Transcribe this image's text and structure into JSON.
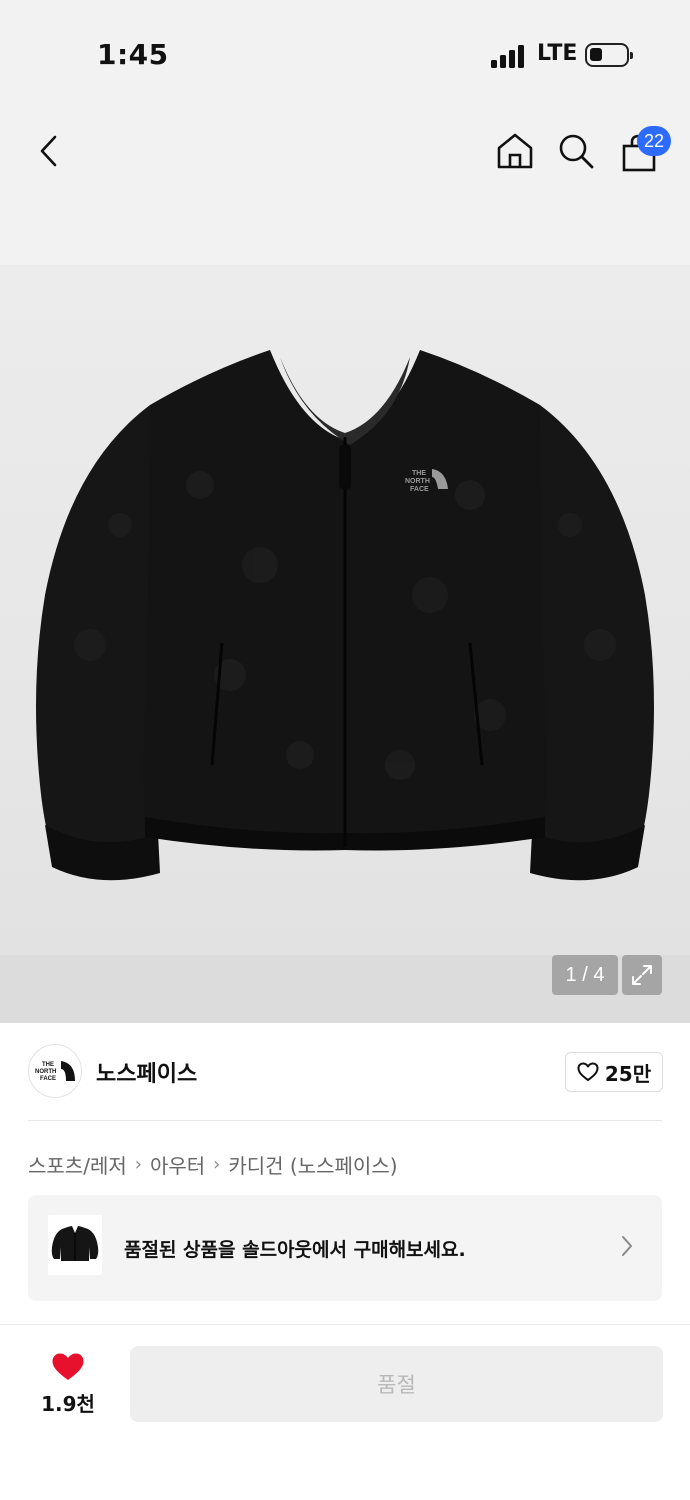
{
  "status_bar": {
    "time": "1:45",
    "network": "LTE",
    "icons": [
      "signal-icon",
      "battery-icon"
    ]
  },
  "nav": {
    "back_icon": "chevron-left-icon",
    "home_icon": "home-icon",
    "search_icon": "search-icon",
    "bag_icon": "shopping-bag-icon",
    "bag_count": "22",
    "accent_color": "#2d6bff"
  },
  "gallery": {
    "pager": "1 / 4",
    "expand_icon": "expand-icon",
    "image": "black fleece cardigan jacket"
  },
  "brand": {
    "name": "노스페이스",
    "logo_icon": "brand-logo-icon",
    "likes": "25만"
  },
  "breadcrumb": [
    "스포츠/레저",
    "아우터",
    "카디건 (노스페이스)"
  ],
  "soldout": {
    "message": "품절된 상품을 솔드아웃에서 구매해보세요."
  },
  "footer": {
    "wish_count": "1.9천",
    "wish_color": "#e8112d",
    "buy_label": "품절"
  }
}
